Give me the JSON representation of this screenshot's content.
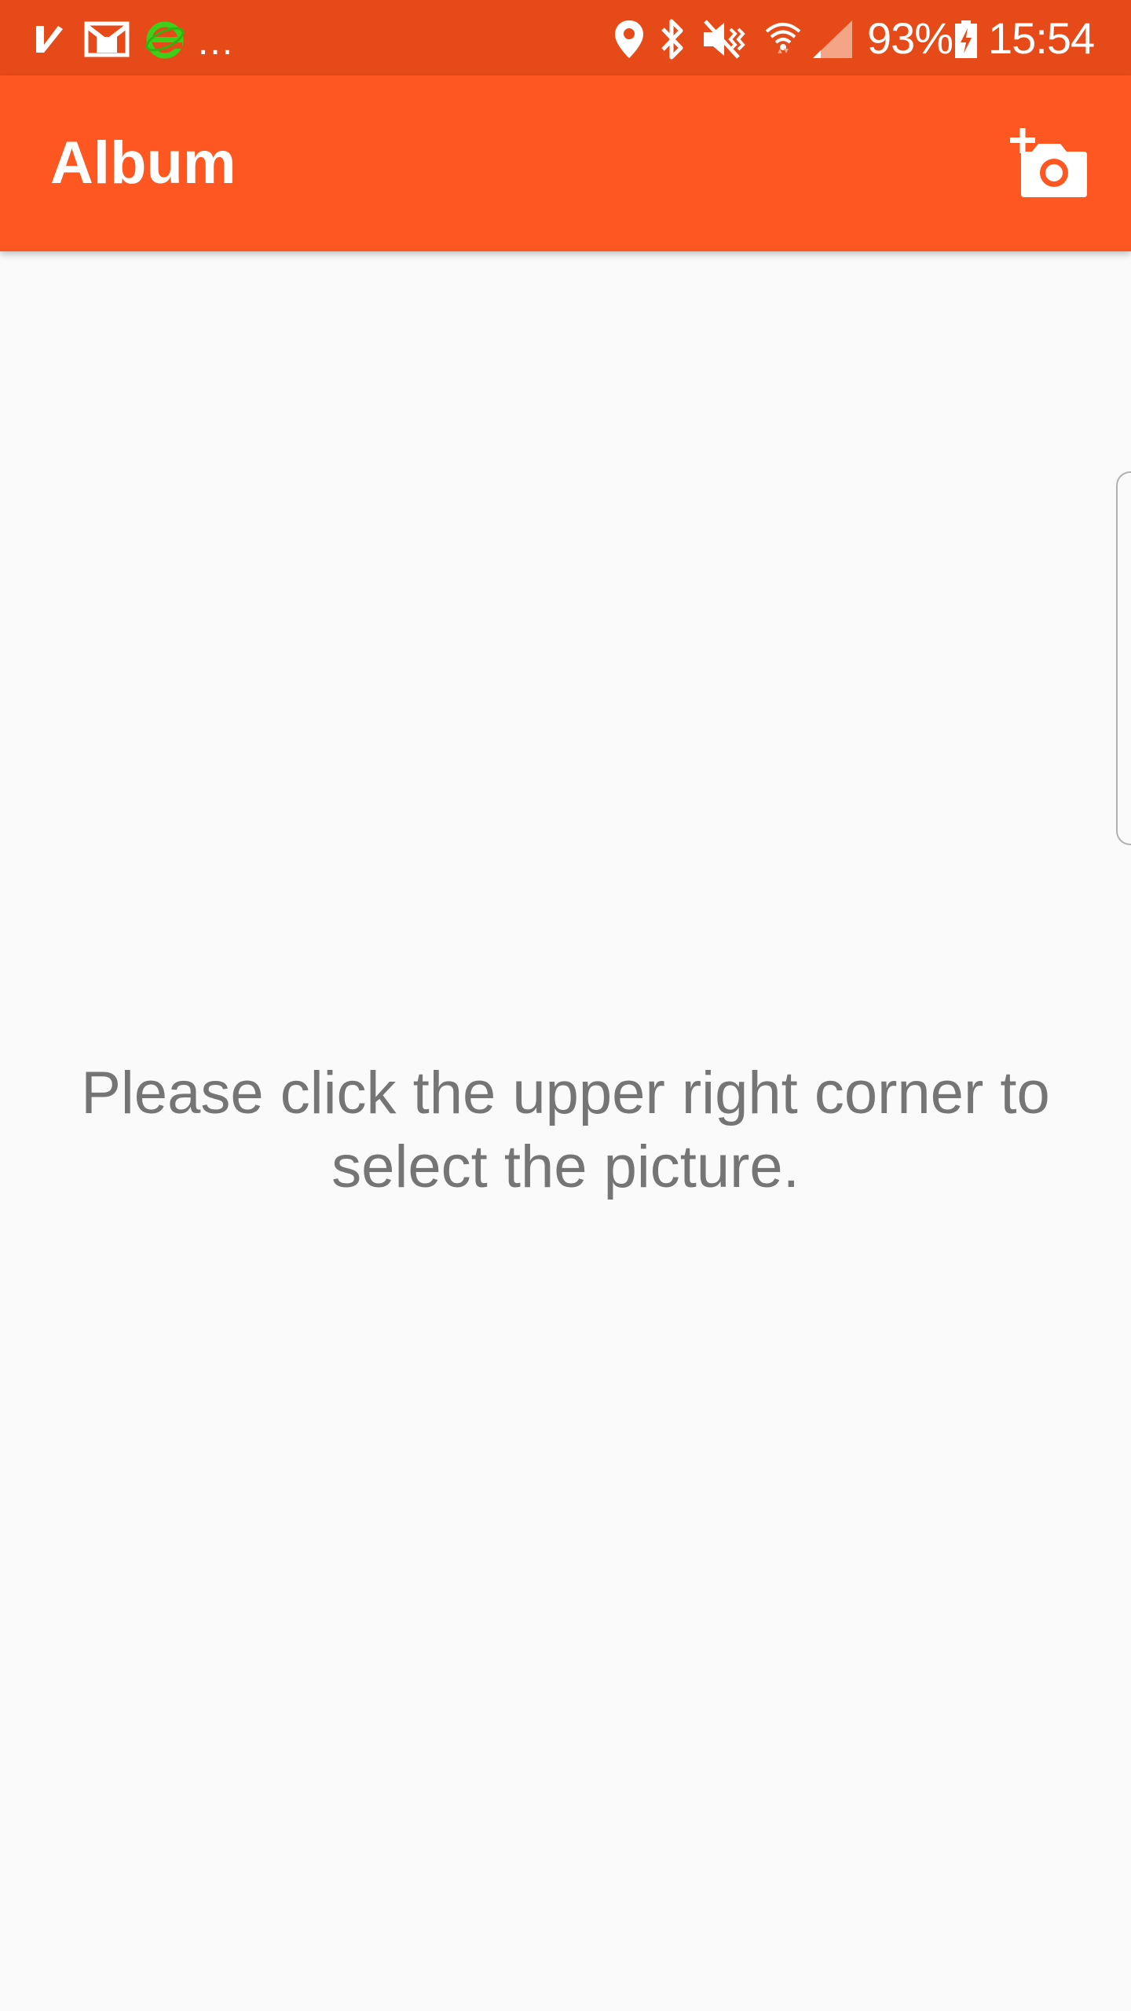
{
  "status_bar": {
    "background_color": "#e64a19",
    "left_icons": [
      "checkmark-notification-icon",
      "mail-icon",
      "browser-e-icon"
    ],
    "overflow_dots": "...",
    "right_icons": [
      "location-icon",
      "bluetooth-icon",
      "vibrate-mute-icon",
      "wifi-icon",
      "signal-icon"
    ],
    "battery_percent": "93%",
    "battery_icon": "battery-charging-icon",
    "time": "15:54"
  },
  "app_bar": {
    "background_color": "#ff5722",
    "title": "Album",
    "action_icon": "add-photo-icon"
  },
  "main": {
    "background_color": "#fafafa",
    "message": "Please click the upper right corner to select the picture.",
    "message_color": "#757575"
  }
}
